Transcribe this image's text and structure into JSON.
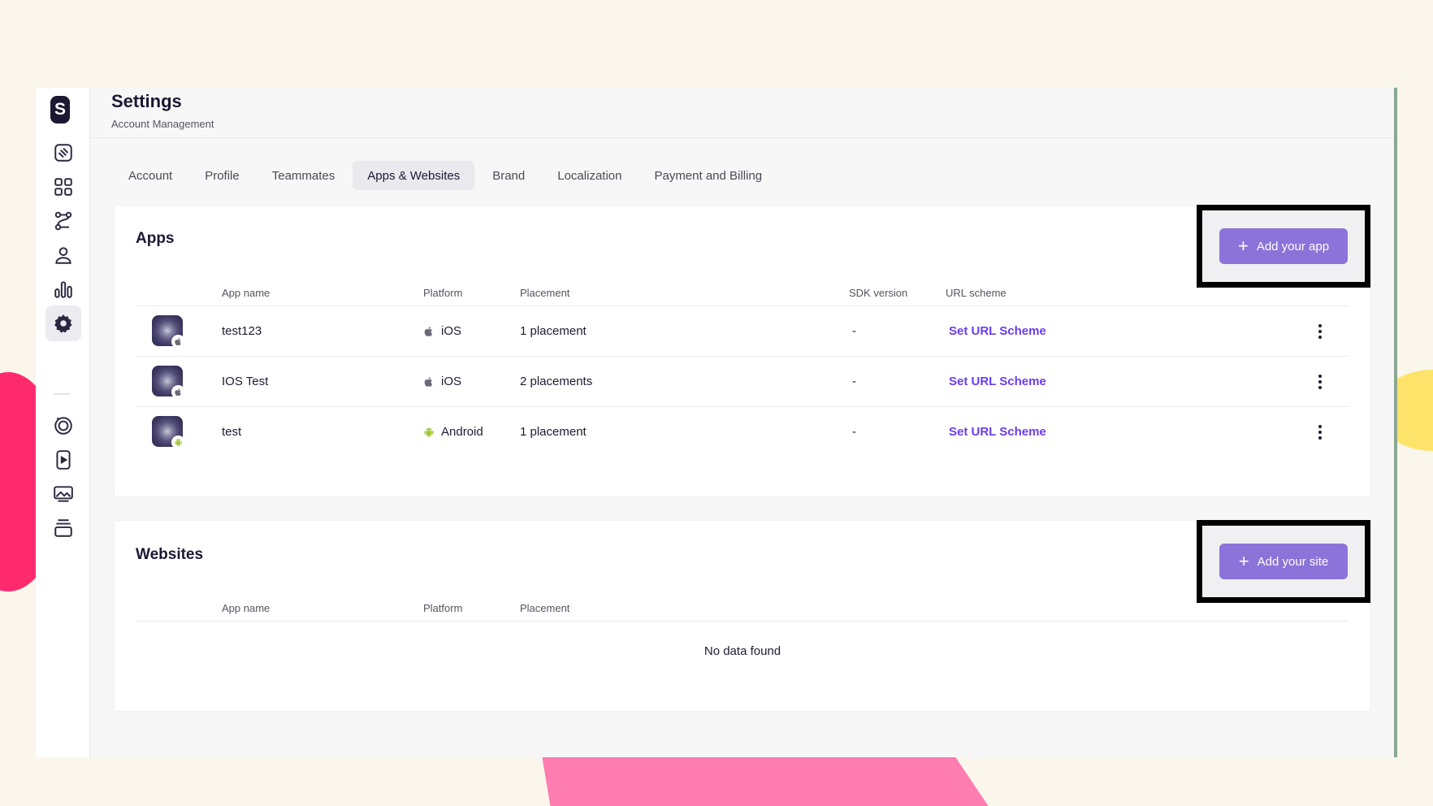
{
  "header": {
    "title": "Settings",
    "subtitle": "Account Management"
  },
  "brand": {
    "letter": "S"
  },
  "sidebar": {
    "items": [
      {
        "icon": "puzzle-icon",
        "active": false
      },
      {
        "icon": "grid-icon",
        "active": false
      },
      {
        "icon": "flow-icon",
        "active": false
      },
      {
        "icon": "user-icon",
        "active": false
      },
      {
        "icon": "chart-icon",
        "active": false
      },
      {
        "icon": "gear-icon",
        "active": true
      },
      {
        "icon": "target-icon",
        "active": false
      },
      {
        "icon": "video-icon",
        "active": false
      },
      {
        "icon": "image-icon",
        "active": false
      },
      {
        "icon": "stack-icon",
        "active": false
      }
    ]
  },
  "tabs": [
    {
      "label": "Account"
    },
    {
      "label": "Profile"
    },
    {
      "label": "Teammates"
    },
    {
      "label": "Apps & Websites",
      "active": true
    },
    {
      "label": "Brand"
    },
    {
      "label": "Localization"
    },
    {
      "label": "Payment and Billing"
    }
  ],
  "apps": {
    "title": "Apps",
    "add_button": "Add your app",
    "columns": [
      "App name",
      "Platform",
      "Placement",
      "SDK version",
      "URL scheme"
    ],
    "rows": [
      {
        "name": "test123",
        "platform": "iOS",
        "placement": "1 placement",
        "sdk": "-",
        "url": "Set URL Scheme"
      },
      {
        "name": "IOS Test",
        "platform": "iOS",
        "placement": "2 placements",
        "sdk": "-",
        "url": "Set URL Scheme"
      },
      {
        "name": "test",
        "platform": "Android",
        "placement": "1 placement",
        "sdk": "-",
        "url": "Set URL Scheme"
      }
    ]
  },
  "websites": {
    "title": "Websites",
    "add_button": "Add your site",
    "columns": [
      "App name",
      "Platform",
      "Placement"
    ],
    "empty_text": "No data found"
  },
  "colors": {
    "accent": "#8b73d9",
    "link": "#6b3cf0",
    "brand_dark": "#1b1832",
    "android_green": "#a4c639"
  }
}
